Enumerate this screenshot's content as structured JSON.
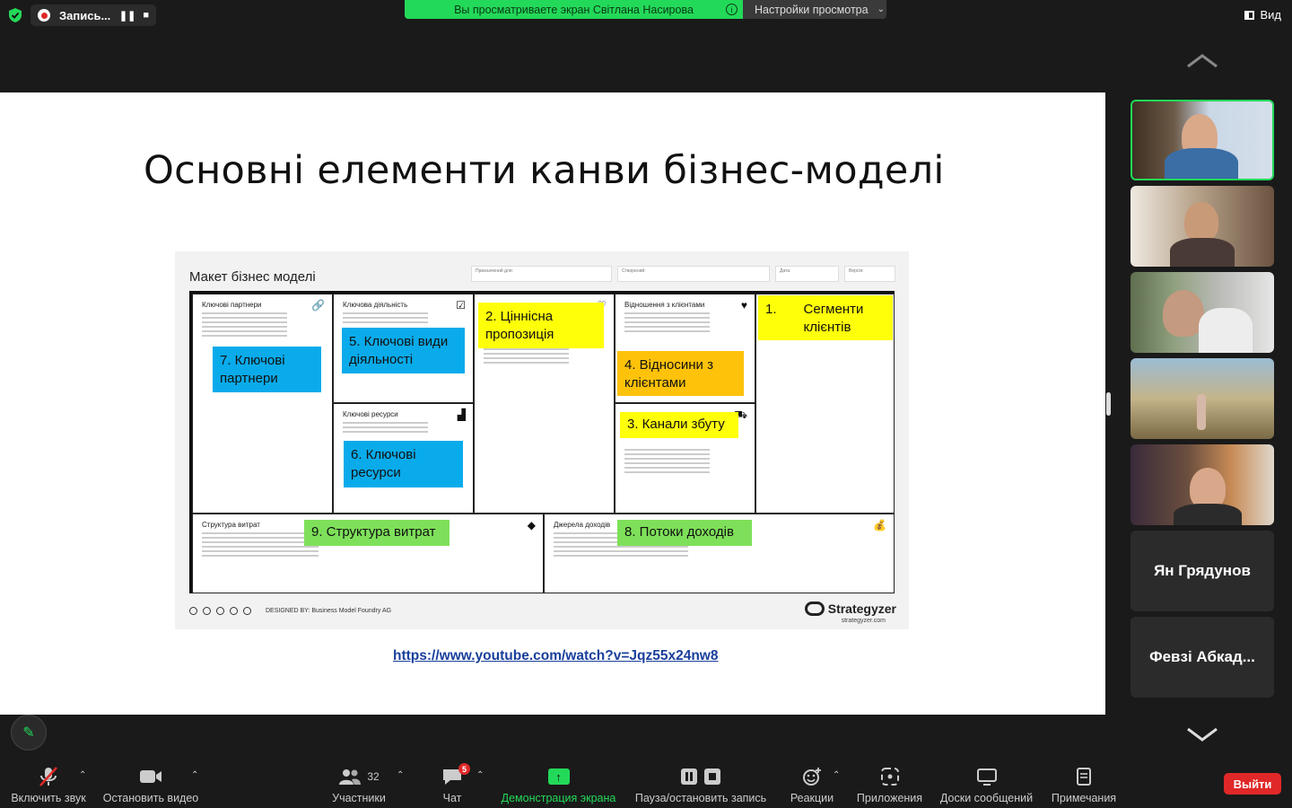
{
  "top_bar": {
    "recording_label": "Запись...",
    "share_banner": "Вы просматриваете экран Світлана Насирова",
    "view_settings": "Настройки просмотра",
    "view_button": "Вид"
  },
  "slide": {
    "title": "Основні елементи канви бізнес-моделі",
    "canvas": {
      "heading": "Макет бізнес моделі",
      "meta_fields": [
        "Призначений для:",
        "Створений:",
        "Дата:",
        "Версія:"
      ],
      "cells": {
        "key_partners": "Ключові партнери",
        "key_activities": "Ключова діяльність",
        "key_resources": "Ключові ресурси",
        "customer_relationships": "Відношення з клієнтами",
        "cost_structure": "Структура витрат",
        "revenue_streams": "Джерела доходів"
      },
      "notes": {
        "n1_num": "1.",
        "n1_text": "Сегменти клієнтів",
        "n2": "2. Ціннісна пропозиція",
        "n3": "3. Канали збуту",
        "n4": "4. Відносини з клієнтами",
        "n5": "5. Ключові види діяльності",
        "n6": "6. Ключові ресурси",
        "n7": "7. Ключові партнери",
        "n8": "8. Потоки доходів",
        "n9": "9. Структура витрат"
      },
      "designed_by": "DESIGNED BY: Business Model Foundry AG",
      "brand": "Strategyzer",
      "brand_url": "strategyzer.com"
    },
    "link": "https://www.youtube.com/watch?v=Jqz55x24nw8"
  },
  "gallery": {
    "tiles": [
      {
        "type": "video",
        "active": true
      },
      {
        "type": "video",
        "active": false
      },
      {
        "type": "video",
        "active": false
      },
      {
        "type": "video",
        "active": false
      },
      {
        "type": "video",
        "active": false
      },
      {
        "type": "name",
        "name": "Ян Грядунов"
      },
      {
        "type": "name",
        "name": "Февзі Абкад..."
      }
    ]
  },
  "toolbar": {
    "unmute": "Включить звук",
    "stop_video": "Остановить видео",
    "participants": "Участники",
    "participants_count": "32",
    "chat": "Чат",
    "chat_badge": "5",
    "share_screen": "Демонстрация экрана",
    "pause_recording": "Пауза/остановить запись",
    "reactions": "Реакции",
    "apps": "Приложения",
    "whiteboards": "Доски сообщений",
    "notes": "Примечания",
    "leave": "Выйти"
  },
  "colors": {
    "accent_green": "#23d959",
    "leave_red": "#e02828",
    "note_blue": "#0aabeb",
    "note_yellow": "#ffff0a",
    "note_orange": "#ffc20a",
    "note_green": "#7ee05a"
  }
}
